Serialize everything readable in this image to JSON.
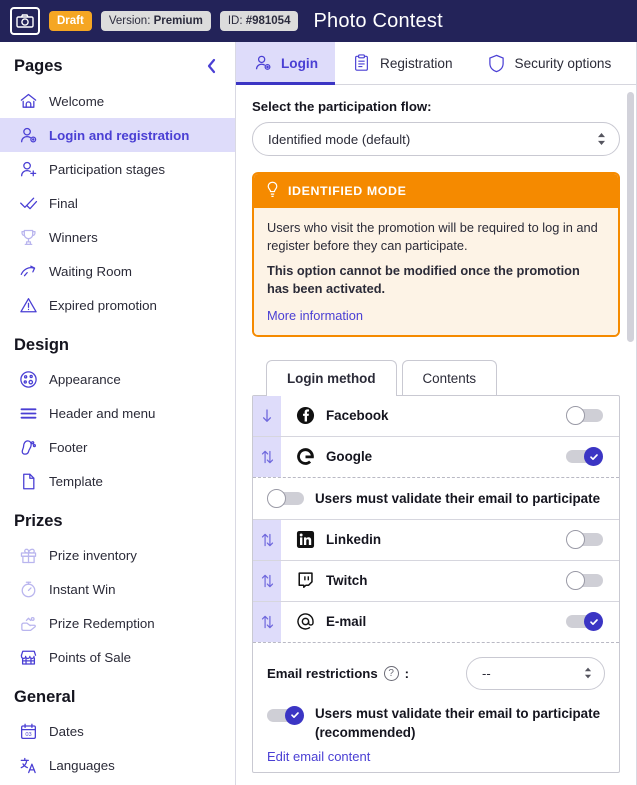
{
  "header": {
    "logo_icon": "camera-icon",
    "status_badge": "Draft",
    "version_label": "Version: ",
    "version_value": "Premium",
    "id_label": "ID: ",
    "id_value": "#981054",
    "title": "Photo Contest",
    "colors": {
      "bar": "#232359",
      "draft": "#f5a623",
      "badge": "#dcdcdc"
    }
  },
  "sidebar": {
    "title": "Pages",
    "collapse_icon": "chevron-left-icon",
    "sections": [
      {
        "title": "Pages",
        "show_title": false,
        "items": [
          {
            "label": "Welcome",
            "icon": "home-icon",
            "active": false,
            "dim": false
          },
          {
            "label": "Login and registration",
            "icon": "user-gear-icon",
            "active": true,
            "dim": false
          },
          {
            "label": "Participation stages",
            "icon": "user-add-icon",
            "active": false,
            "dim": false
          },
          {
            "label": "Final",
            "icon": "check-double-icon",
            "active": false,
            "dim": false
          },
          {
            "label": "Winners",
            "icon": "trophy-icon",
            "active": false,
            "dim": true
          },
          {
            "label": "Waiting Room",
            "icon": "hourglass-arrow-icon",
            "active": false,
            "dim": false
          },
          {
            "label": "Expired promotion",
            "icon": "warning-triangle-icon",
            "active": false,
            "dim": false
          }
        ]
      },
      {
        "title": "Design",
        "show_title": true,
        "items": [
          {
            "label": "Appearance",
            "icon": "palette-icon",
            "active": false,
            "dim": false
          },
          {
            "label": "Header and menu",
            "icon": "menu-lines-icon",
            "active": false,
            "dim": false
          },
          {
            "label": "Footer",
            "icon": "footprint-icon",
            "active": false,
            "dim": false
          },
          {
            "label": "Template",
            "icon": "page-icon",
            "active": false,
            "dim": false
          }
        ]
      },
      {
        "title": "Prizes",
        "show_title": true,
        "items": [
          {
            "label": "Prize inventory",
            "icon": "gift-icon",
            "active": false,
            "dim": true
          },
          {
            "label": "Instant Win",
            "icon": "stopwatch-icon",
            "active": false,
            "dim": true
          },
          {
            "label": "Prize Redemption",
            "icon": "hand-gift-icon",
            "active": false,
            "dim": true
          },
          {
            "label": "Points of Sale",
            "icon": "shop-icon",
            "active": false,
            "dim": false
          }
        ]
      },
      {
        "title": "General",
        "show_title": true,
        "items": [
          {
            "label": "Dates",
            "icon": "calendar-icon",
            "icon_text": "03",
            "active": false,
            "dim": false
          },
          {
            "label": "Languages",
            "icon": "translate-icon",
            "active": false,
            "dim": false
          }
        ]
      }
    ]
  },
  "main": {
    "tabs": [
      {
        "label": "Login",
        "icon": "user-gear-icon",
        "active": true
      },
      {
        "label": "Registration",
        "icon": "clipboard-icon",
        "active": false
      },
      {
        "label": "Security options",
        "icon": "shield-icon",
        "active": false
      }
    ],
    "flow": {
      "label": "Select the participation flow:",
      "selected": "Identified mode (default)"
    },
    "callout": {
      "icon": "lightbulb-icon",
      "heading": "IDENTIFIED MODE",
      "paragraph": "Users who visit the promotion will be required to log in and register before they can participate.",
      "bold_paragraph": "This option cannot be modified once the promotion has been activated.",
      "link": "More information",
      "colors": {
        "border": "#f58a00",
        "head_bg": "#f58a00",
        "body_bg": "#fdf3e6"
      }
    },
    "subtabs": [
      {
        "label": "Login method",
        "active": true
      },
      {
        "label": "Contents",
        "active": false
      }
    ],
    "login_methods": [
      {
        "name": "Facebook",
        "icon": "facebook-icon",
        "handle": "arrow-down-icon",
        "enabled": false
      },
      {
        "name": "Google",
        "icon": "google-icon",
        "handle": "arrow-up-down-icon",
        "enabled": true
      },
      {
        "name": "Linkedin",
        "icon": "linkedin-icon",
        "handle": "arrow-up-down-icon",
        "enabled": false
      },
      {
        "name": "Twitch",
        "icon": "twitch-icon",
        "handle": "arrow-up-down-icon",
        "enabled": false
      },
      {
        "name": "E-mail",
        "icon": "at-sign-icon",
        "handle": "arrow-up-down-icon",
        "enabled": true
      }
    ],
    "google_suboption": {
      "label": "Users must validate their email to participate",
      "enabled": false
    },
    "email_settings": {
      "restrictions_label": "Email restrictions",
      "help_icon": "question-mark-icon",
      "colon": ":",
      "restrictions_value": "--",
      "validate_label": "Users must validate their email to participate (recommended)",
      "validate_enabled": true,
      "edit_link": "Edit email content"
    }
  }
}
